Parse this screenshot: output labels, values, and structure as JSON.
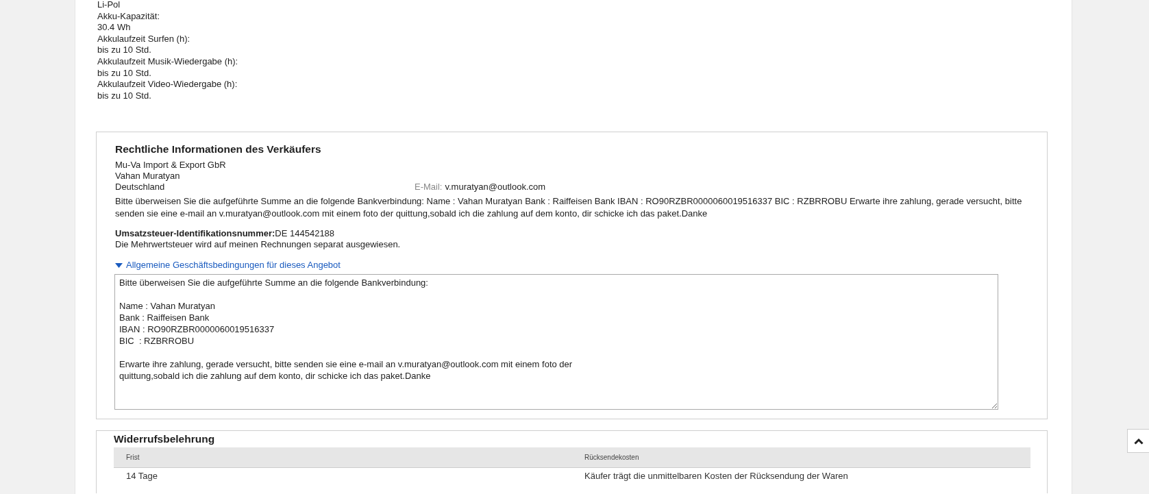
{
  "specs": [
    "Li-Pol",
    "Akku-Kapazität:",
    "30.4 Wh",
    "Akkulaufzeit Surfen (h):",
    "bis zu 10 Std.",
    "Akkulaufzeit Musik-Wiedergabe (h):",
    "bis zu 10 Std.",
    "Akkulaufzeit Video-Wiedergabe (h):",
    "bis zu 10 Std."
  ],
  "seller_info": {
    "title": "Rechtliche Informationen des Verkäufers",
    "address": [
      "Mu-Va Import & Export GbR",
      "Vahan Muratyan",
      "Deutschland"
    ],
    "email_label": "E-Mail:",
    "email": "v.muratyan@outlook.com",
    "payment_note": "Bitte überweisen Sie die aufgeführte Summe an die folgende Bankverbindung: Name : Vahan Muratyan Bank : Raiffeisen Bank IBAN : RO90RZBR0000060019516337 BIC : RZBRROBU Erwarte ihre zahlung, gerade versucht, bitte senden sie eine e-mail an v.muratyan@outlook.com mit einem foto der quittung,sobald ich die zahlung auf dem konto, dir schicke ich das paket.Danke",
    "vat": "**Umsatzsteuer-Identifikationsnummer:**DE 144542188",
    "vat_note": "Die Mehrwertsteuer wird auf meinen Rechnungen separat ausgewiesen.",
    "terms_toggle": {
      "label": "Allgemeine Geschäftsbedingungen für dieses Angebot",
      "expanded": true
    },
    "terms_text": [
      [
        "Bitte überweisen Sie die aufgeführte Summe an die folgende Bankverbindung:"
      ],
      [
        "Name : Vahan Muratyan",
        "Bank : Raiffeisen Bank",
        "IBAN : RO90RZBR0000060019516337",
        "BIC  : RZBRROBU"
      ],
      [
        "Erwarte ihre zahlung, gerade versucht, bitte senden sie eine e-mail an v.muratyan@outlook.com mit einem foto der",
        "quittung,sobald ich die zahlung auf dem konto, dir schicke ich das paket.Danke"
      ]
    ]
  },
  "withdrawal": {
    "title": "Widerrufsbelehrung",
    "columns": [
      "Frist",
      "Rücksendekosten"
    ],
    "rows": [
      [
        "14 Tage",
        "Käufer trägt die unmittelbaren Kosten der Rücksendung der Waren"
      ]
    ]
  }
}
